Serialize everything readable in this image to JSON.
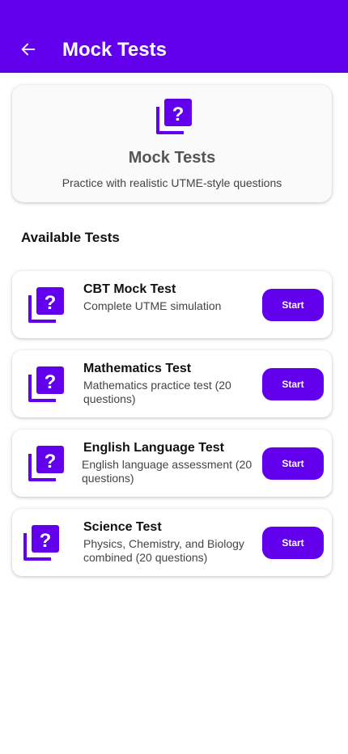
{
  "header": {
    "title": "Mock Tests",
    "back_icon": "arrow-left-icon",
    "background": "#6200ee"
  },
  "hero": {
    "icon": "quiz-icon",
    "title": "Mock Tests",
    "subtitle": "Practice with realistic UTME-style questions"
  },
  "section": {
    "title": "Available Tests"
  },
  "tests": [
    {
      "title": "CBT Mock Test",
      "description": "Complete UTME simulation",
      "button": "Start",
      "icon": "quiz-icon"
    },
    {
      "title": "Mathematics Test",
      "description": "Mathematics practice test (20 questions)",
      "button": "Start",
      "icon": "quiz-icon"
    },
    {
      "title": "English Language Test",
      "description": "English language assessment (20 questions)",
      "button": "Start",
      "icon": "quiz-icon"
    },
    {
      "title": "Science Test",
      "description": "Physics, Chemistry, and Biology combined (20 questions)",
      "button": "Start",
      "icon": "quiz-icon"
    }
  ],
  "colors": {
    "primary": "#6200ee"
  }
}
